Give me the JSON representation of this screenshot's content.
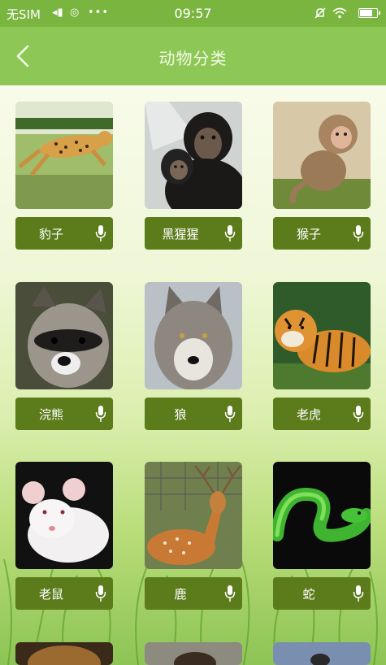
{
  "status_bar": {
    "carrier": "无SIM",
    "time": "09:57"
  },
  "nav": {
    "title": "动物分类",
    "back_icon": "chevron-left-icon"
  },
  "animals": [
    {
      "name": "豹子"
    },
    {
      "name": "黑猩猩"
    },
    {
      "name": "猴子"
    },
    {
      "name": "浣熊"
    },
    {
      "name": "狼"
    },
    {
      "name": "老虎"
    },
    {
      "name": "老鼠"
    },
    {
      "name": "鹿"
    },
    {
      "name": "蛇"
    }
  ],
  "label_icon": "microphone-icon",
  "colors": {
    "status_bar": "#7ab540",
    "nav_bar": "#8dc755",
    "label_bg": "#5c7c1c"
  }
}
